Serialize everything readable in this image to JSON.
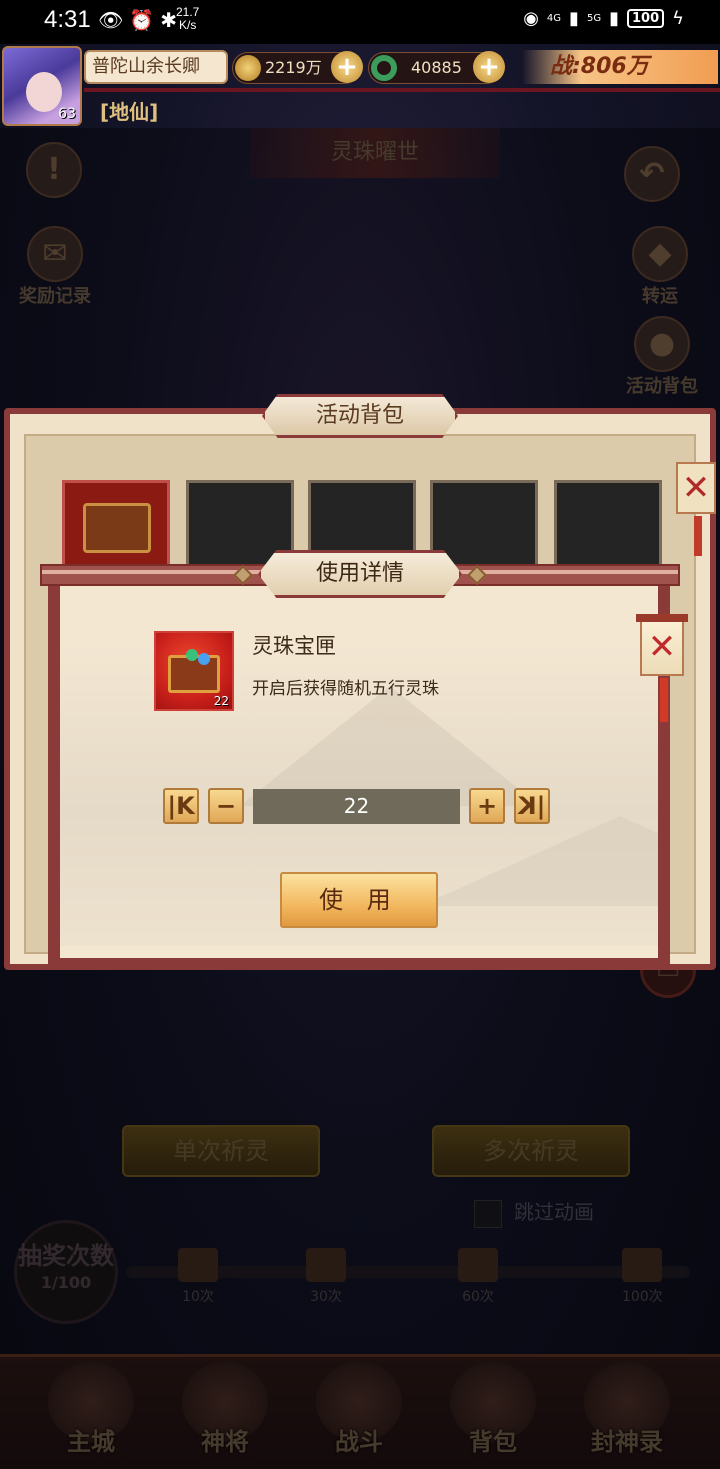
{
  "status_bar": {
    "time": "4:31",
    "speed_value": "21.7",
    "speed_unit": "K/s",
    "battery": "100",
    "net1": "4G",
    "net2": "5G"
  },
  "player": {
    "name": "普陀山余长卿",
    "level": "63",
    "rank": "[地仙]",
    "coins": "2219万",
    "jade": "40885",
    "power": "战:806万"
  },
  "event": {
    "title": "灵珠曜世",
    "reward_log_label": "奖励记录",
    "luck_label": "转运",
    "activity_bag_label": "活动背包"
  },
  "bag": {
    "title": "活动背包"
  },
  "modal": {
    "title": "使用详情",
    "item": {
      "name": "灵珠宝匣",
      "description": "开启后获得随机五行灵珠",
      "count": "22"
    },
    "quantity": "22",
    "use_label": "使 用",
    "first_label": "K",
    "minus_label": "−",
    "plus_label": "+",
    "last_label": "K",
    "close_label": "✕"
  },
  "background": {
    "single_draw": "单次祈灵",
    "multi_draw": "多次祈灵",
    "skip_animation": "跳过动画",
    "draw_count_title": "抽奖次数",
    "draw_count_value": "1/100",
    "milestones": [
      "10次",
      "30次",
      "60次",
      "100次"
    ]
  },
  "nav": [
    "主城",
    "神将",
    "战斗",
    "背包",
    "封神录"
  ]
}
